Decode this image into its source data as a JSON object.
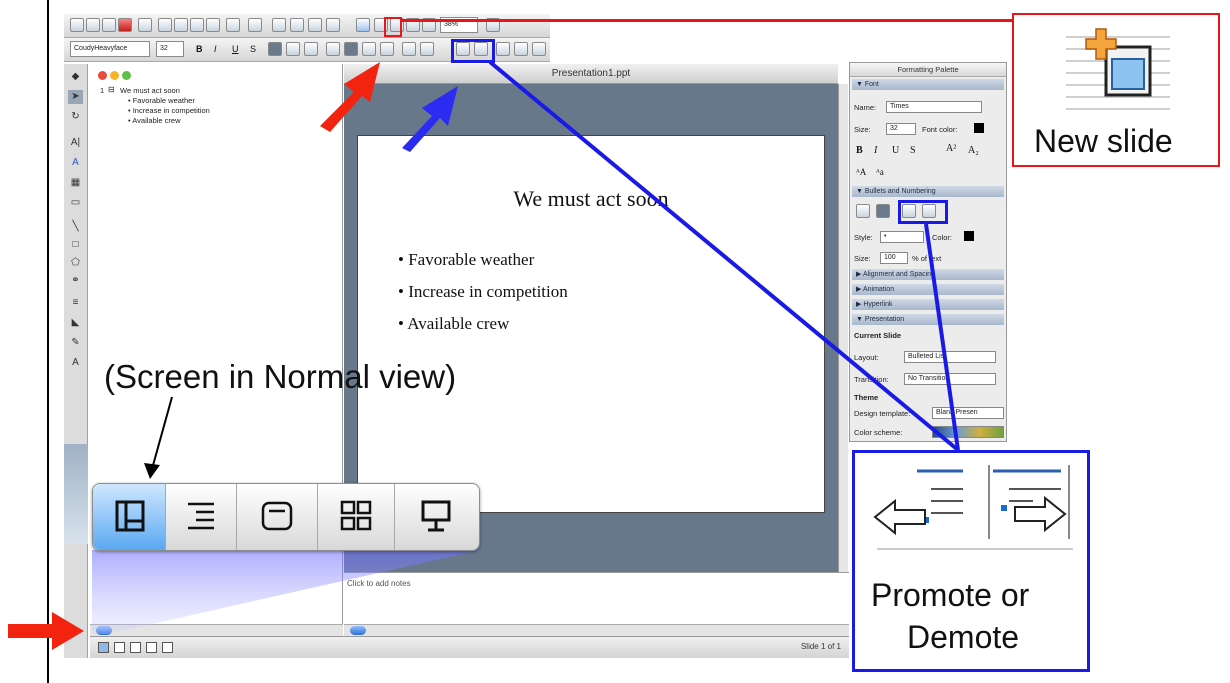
{
  "toolbar": {
    "font_name": "CoudyHeavyface",
    "font_size": "32",
    "zoom": "38%",
    "format_buttons": [
      "B",
      "I",
      "U",
      "S"
    ]
  },
  "outline": {
    "slide_number": "1",
    "title": "We must act soon",
    "bullets": [
      "Favorable weather",
      "Increase in competition",
      "Available crew"
    ]
  },
  "window": {
    "title": "Presentation1.ppt"
  },
  "slide": {
    "title": "We must act soon",
    "bullets": [
      "Favorable weather",
      "Increase in competition",
      "Available crew"
    ]
  },
  "notes": {
    "placeholder": "Click to add notes"
  },
  "status": {
    "slide_indicator": "Slide 1 of 1"
  },
  "palette": {
    "title": "Formatting Palette",
    "font_section": "Font",
    "name_label": "Name:",
    "name_value": "Times",
    "size_label": "Size:",
    "size_value": "32",
    "font_color_label": "Font color:",
    "bullets_section": "Bullets and Numbering",
    "style_label": "Style:",
    "style_value": "•",
    "color_label": "Color:",
    "bsize_label": "Size:",
    "bsize_value": "100",
    "bsize_suffix": "% of text",
    "align_section": "Alignment and Spacing",
    "animation_section": "Animation",
    "hyperlink_section": "Hyperlink",
    "presentation_section": "Presentation",
    "current_slide": "Current Slide",
    "layout_label": "Layout:",
    "layout_value": "Bulleted List",
    "transition_label": "Transition:",
    "transition_value": "No Transition",
    "theme": "Theme",
    "design_label": "Design template:",
    "design_value": "Blank Presen",
    "scheme_label": "Color scheme:"
  },
  "callouts": {
    "new_slide": "New slide",
    "promote_demote_line1": "Promote or",
    "promote_demote_line2": "Demote",
    "normal_view": "(Screen in Normal view)"
  },
  "colors": {
    "red_callout": "#e8151b",
    "blue_callout": "#1a1ae6",
    "slide_background_area": "#68788b"
  }
}
